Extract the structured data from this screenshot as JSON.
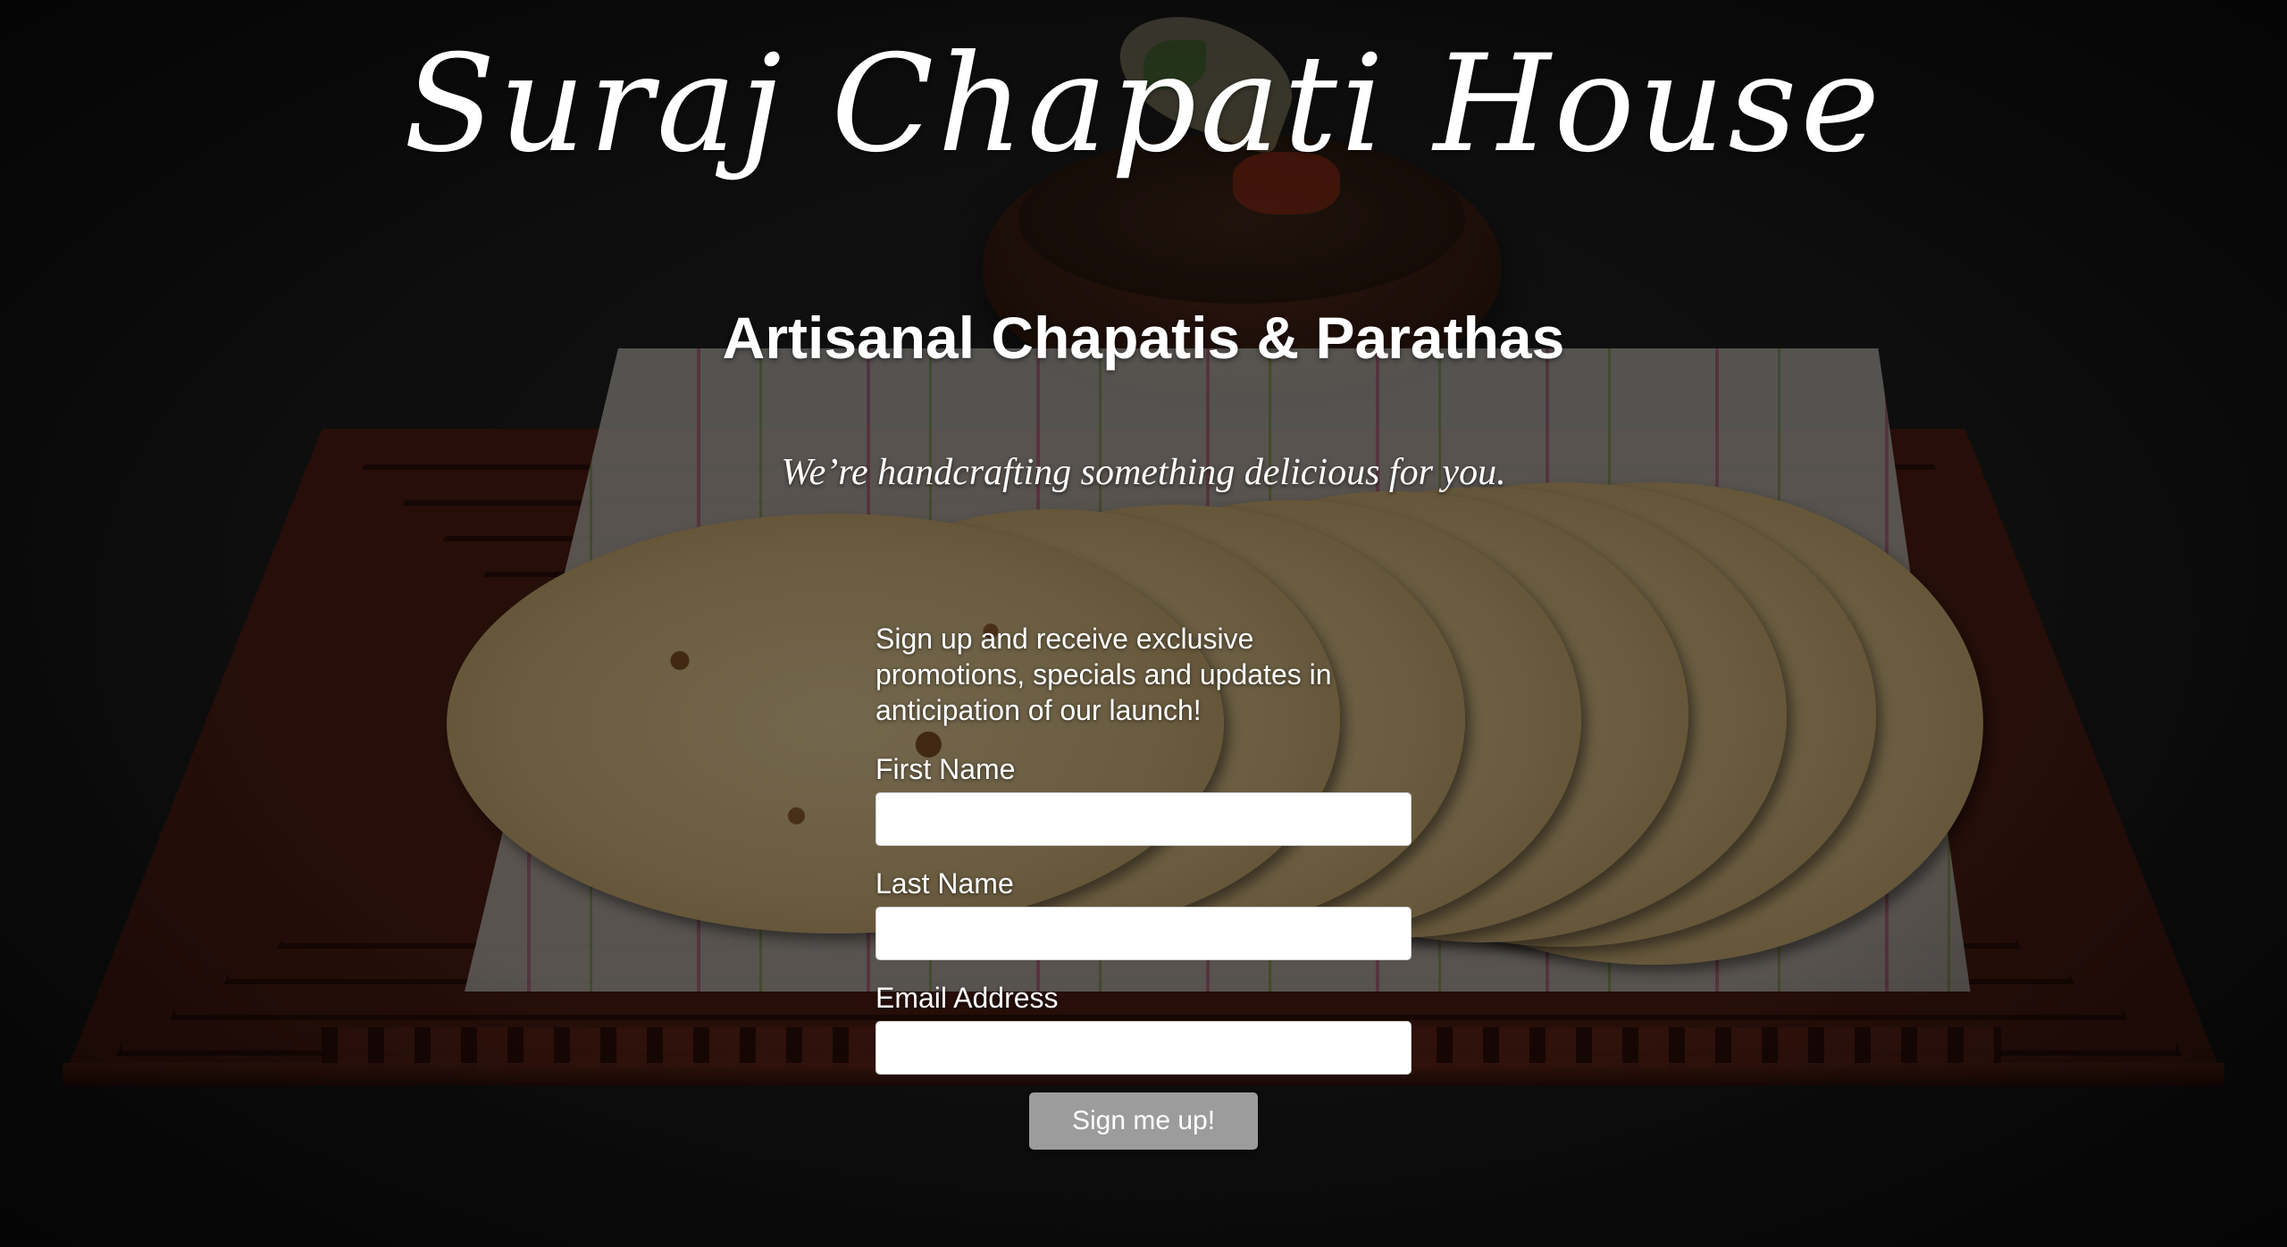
{
  "header": {
    "brand": "Suraj Chapati House",
    "tagline": "Artisanal Chapatis & Parathas",
    "subtagline": "We’re handcrafting something delicious for you."
  },
  "signup": {
    "intro": "Sign up and receive exclusive promotions, specials and updates in anticipation of our launch!",
    "first_name_label": "First Name",
    "first_name_value": "",
    "last_name_label": "Last Name",
    "last_name_value": "",
    "email_label": "Email Address",
    "email_value": "",
    "submit_label": "Sign me up!"
  },
  "theme": {
    "text_color": "#ffffff",
    "button_color": "#9c9c9c",
    "input_background": "#ffffff",
    "background_photo": "chapatis-on-wooden-tray-with-chana-bowl"
  }
}
